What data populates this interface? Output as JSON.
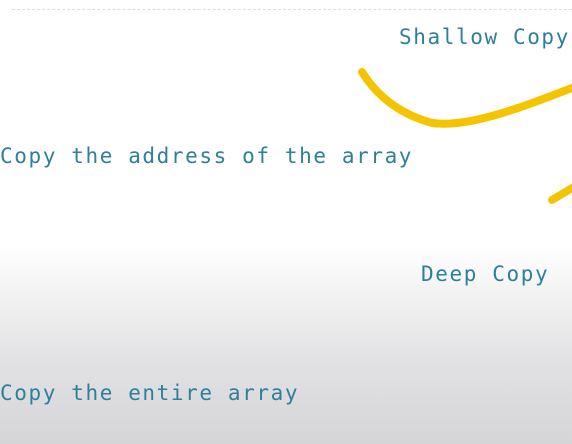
{
  "slide": {
    "shallow_copy_label": "Shallow Copy",
    "address_copy_text": "Copy the address of the array",
    "deep_copy_label": "Deep Copy",
    "entire_copy_text": "Copy the entire array",
    "accent_text_color": "#2e7f9a",
    "annotation_color": "#f5c400"
  }
}
